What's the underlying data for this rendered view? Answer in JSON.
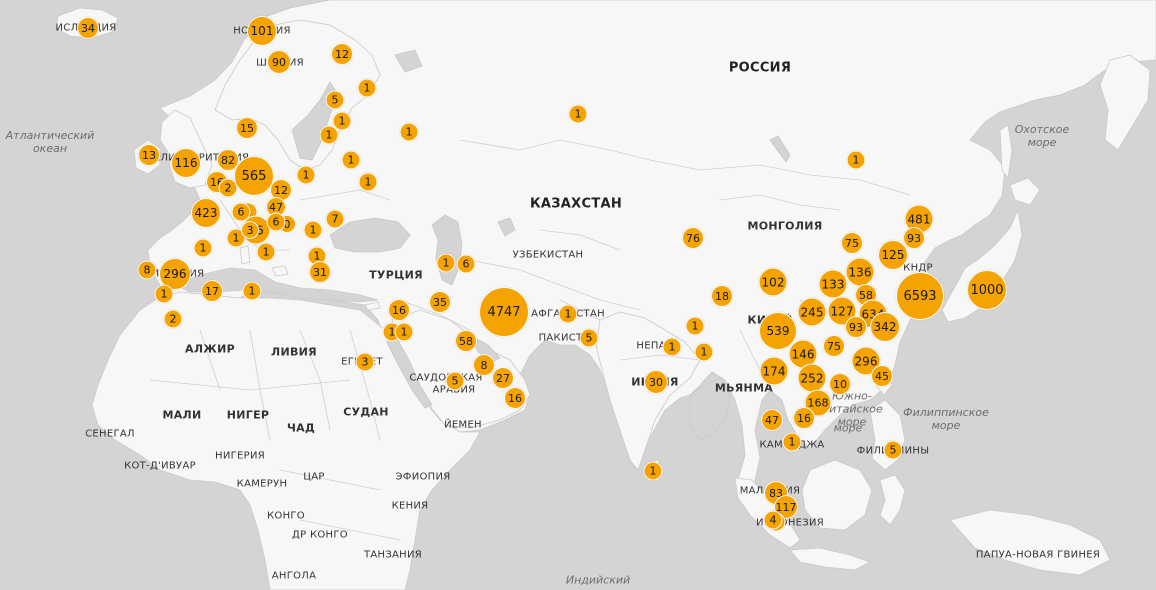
{
  "country_labels": [
    {
      "text": "РОССИЯ",
      "cls": "big"
    },
    {
      "text": "КАЗАХСТАН",
      "cls": "big"
    },
    {
      "text": "МОНГОЛИЯ",
      "cls": "mid"
    },
    {
      "text": "УЗБЕКИСТАН",
      "cls": ""
    },
    {
      "text": "ТУРЦИЯ",
      "cls": "mid"
    },
    {
      "text": "АФГАНИСТАН",
      "cls": ""
    },
    {
      "text": "ПАКИСТАН",
      "cls": ""
    },
    {
      "text": "ИНДИЯ",
      "cls": "mid"
    },
    {
      "text": "НЕПАЛ",
      "cls": ""
    },
    {
      "text": "МЬЯНМА",
      "cls": "mid"
    },
    {
      "text": "КНДР",
      "cls": ""
    },
    {
      "text": "КИТАЙ",
      "cls": "mid"
    },
    {
      "text": "ИСЛАНДИЯ",
      "cls": ""
    },
    {
      "text": "НОРВЕГИЯ",
      "cls": ""
    },
    {
      "text": "ШВЕЦИЯ",
      "cls": ""
    },
    {
      "text": "ВЕЛИКОБРИТАНИЯ",
      "cls": ""
    },
    {
      "text": "ИСПАНИЯ",
      "cls": ""
    },
    {
      "text": "АЛЖИР",
      "cls": "mid"
    },
    {
      "text": "ЛИВИЯ",
      "cls": "mid"
    },
    {
      "text": "ЕГИПЕТ",
      "cls": ""
    },
    {
      "text": "САУДОВСКАЯ",
      "cls": ""
    },
    {
      "text": "АРАВИЯ",
      "cls": ""
    },
    {
      "text": "ЙЕМЕН",
      "cls": ""
    },
    {
      "text": "МАЛИ",
      "cls": "mid"
    },
    {
      "text": "НИГЕР",
      "cls": "mid"
    },
    {
      "text": "ЧАД",
      "cls": "mid"
    },
    {
      "text": "СУДАН",
      "cls": "mid"
    },
    {
      "text": "СЕНЕГАЛ",
      "cls": ""
    },
    {
      "text": "НИГЕРИЯ",
      "cls": ""
    },
    {
      "text": "КОТ-Д'ИВУАР",
      "cls": ""
    },
    {
      "text": "КАМЕРУН",
      "cls": ""
    },
    {
      "text": "ЦАР",
      "cls": ""
    },
    {
      "text": "ЭФИОПИЯ",
      "cls": ""
    },
    {
      "text": "КЕНИЯ",
      "cls": ""
    },
    {
      "text": "КОНГО",
      "cls": ""
    },
    {
      "text": "ДР КОНГО",
      "cls": ""
    },
    {
      "text": "ТАНЗАНИЯ",
      "cls": ""
    },
    {
      "text": "АНГОЛА",
      "cls": ""
    },
    {
      "text": "КАМБОДЖА",
      "cls": ""
    },
    {
      "text": "МАЛАЙЗИЯ",
      "cls": ""
    },
    {
      "text": "ИНДОНЕЗИЯ",
      "cls": ""
    },
    {
      "text": "ФИЛИППИНЫ",
      "cls": ""
    },
    {
      "text": "ПАПУА-НОВАЯ ГВИНЕЯ",
      "cls": ""
    }
  ],
  "water_labels": [
    {
      "text": "Атлантический океан"
    },
    {
      "text": "Охотское море"
    },
    {
      "text": "Южно-Китайское море"
    },
    {
      "text": "Филиппинское море"
    },
    {
      "text": "Индийский"
    },
    {
      "text": "море"
    }
  ],
  "markers": [
    {
      "value": 34
    },
    {
      "value": 101
    },
    {
      "value": 90
    },
    {
      "value": 12
    },
    {
      "value": 5
    },
    {
      "value": 1
    },
    {
      "value": 1
    },
    {
      "value": 1
    },
    {
      "value": 15
    },
    {
      "value": 13
    },
    {
      "value": 116
    },
    {
      "value": 82
    },
    {
      "value": 565
    },
    {
      "value": 16
    },
    {
      "value": 2
    },
    {
      "value": 12
    },
    {
      "value": 47
    },
    {
      "value": 423
    },
    {
      "value": 1
    },
    {
      "value": 6
    },
    {
      "value": 16
    },
    {
      "value": 0
    },
    {
      "value": 1
    },
    {
      "value": 1
    },
    {
      "value": 6
    },
    {
      "value": 1
    },
    {
      "value": 1
    },
    {
      "value": 7
    },
    {
      "value": 1
    },
    {
      "value": 1
    },
    {
      "value": 31
    },
    {
      "value": 1
    },
    {
      "value": 3
    },
    {
      "value": 1
    },
    {
      "value": 1
    },
    {
      "value": 8
    },
    {
      "value": 296
    },
    {
      "value": 1
    },
    {
      "value": 2
    },
    {
      "value": 17
    },
    {
      "value": 1
    },
    {
      "value": 1
    },
    {
      "value": 6
    },
    {
      "value": 16
    },
    {
      "value": 35
    },
    {
      "value": 1
    },
    {
      "value": 1
    },
    {
      "value": 4747
    },
    {
      "value": 58
    },
    {
      "value": 3
    },
    {
      "value": 8
    },
    {
      "value": 27
    },
    {
      "value": 5
    },
    {
      "value": 16
    },
    {
      "value": 1
    },
    {
      "value": 5
    },
    {
      "value": 1
    },
    {
      "value": 1
    },
    {
      "value": 1
    },
    {
      "value": 30
    },
    {
      "value": 1
    },
    {
      "value": 76
    },
    {
      "value": 18
    },
    {
      "value": 102
    },
    {
      "value": 481
    },
    {
      "value": 93
    },
    {
      "value": 75
    },
    {
      "value": 125
    },
    {
      "value": 136
    },
    {
      "value": 133
    },
    {
      "value": 6593
    },
    {
      "value": 1000
    },
    {
      "value": 58
    },
    {
      "value": 245
    },
    {
      "value": 127
    },
    {
      "value": 634
    },
    {
      "value": 539
    },
    {
      "value": 93
    },
    {
      "value": 342
    },
    {
      "value": 146
    },
    {
      "value": 75
    },
    {
      "value": 296
    },
    {
      "value": 174
    },
    {
      "value": 252
    },
    {
      "value": 10
    },
    {
      "value": 45
    },
    {
      "value": 168
    },
    {
      "value": 47
    },
    {
      "value": 16
    },
    {
      "value": 1
    },
    {
      "value": 5
    },
    {
      "value": 1
    },
    {
      "value": 83
    },
    {
      "value": 117
    },
    {
      "value": 4
    },
    {
      "value": 4
    },
    {
      "value": 1
    }
  ],
  "colors": {
    "ocean": "#d4d4d4",
    "land": "#f7f7f7",
    "border": "#c9c9c9",
    "marker": "#f5a300",
    "marker_stroke": "#ffffff"
  }
}
